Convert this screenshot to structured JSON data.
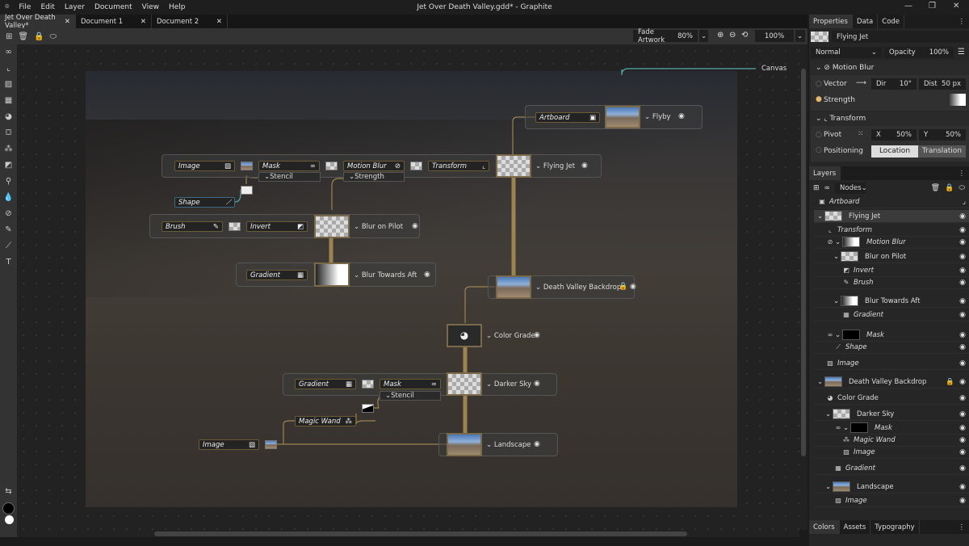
{
  "app": {
    "title": "Jet Over Death Valley.gdd* - Graphite",
    "menu": [
      "File",
      "Edit",
      "Layer",
      "Document",
      "View",
      "Help"
    ]
  },
  "tabs": [
    {
      "label": "Jet Over Death Valley*",
      "active": true
    },
    {
      "label": "Document 1"
    },
    {
      "label": "Document 2"
    }
  ],
  "toolbar": {
    "fade_label": "Fade Artwork",
    "fade_value": "80%",
    "zoom_value": "100%"
  },
  "graph": {
    "canvas_label": "Canvas",
    "flyby": {
      "artboard": "Artboard",
      "label": "Flyby"
    },
    "flying_jet": {
      "image": "Image",
      "mask": "Mask",
      "stencil": "Stencil",
      "motion_blur": "Motion Blur",
      "strength": "Strength",
      "transform": "Transform",
      "label": "Flying Jet",
      "shape": "Shape"
    },
    "blur_on_pilot": {
      "brush": "Brush",
      "invert": "Invert",
      "label": "Blur on Pilot"
    },
    "blur_towards_aft": {
      "gradient": "Gradient",
      "label": "Blur Towards Aft"
    },
    "backdrop": {
      "label": "Death Valley Backdrop"
    },
    "color_grade": {
      "label": "Color Grade"
    },
    "darker_sky": {
      "gradient": "Gradient",
      "mask": "Mask",
      "stencil": "Stencil",
      "magic_wand": "Magic Wand",
      "label": "Darker Sky"
    },
    "landscape": {
      "image": "Image",
      "label": "Landscape"
    }
  },
  "properties": {
    "tabs": [
      "Properties",
      "Data",
      "Code"
    ],
    "layer_name": "Flying Jet",
    "blend_mode": "Normal",
    "opacity_label": "Opacity",
    "opacity_value": "100%",
    "motion_blur": {
      "title": "Motion Blur",
      "vector_label": "Vector",
      "dir_label": "Dir",
      "dir_value": "10°",
      "dist_label": "Dist",
      "dist_value": "50 px",
      "strength_label": "Strength"
    },
    "transform": {
      "title": "Transform",
      "pivot_label": "Pivot",
      "x_label": "X",
      "x_value": "50%",
      "y_label": "Y",
      "y_value": "50%",
      "positioning_label": "Positioning",
      "location": "Location",
      "translation": "Translation"
    }
  },
  "layers": {
    "title": "Layers",
    "view_mode": "Nodes",
    "items": [
      {
        "name": "Artboard",
        "depth": 0,
        "italic": true,
        "icon": "▣"
      },
      {
        "name": "Flying Jet",
        "depth": 0,
        "thumb": "checker",
        "chev": true
      },
      {
        "name": "Transform",
        "depth": 1,
        "italic": true,
        "icon": "⌞"
      },
      {
        "name": "Motion Blur",
        "depth": 1,
        "italic": true,
        "icon": "⊘",
        "thumb": "grad",
        "chev": true
      },
      {
        "name": "Blur on Pilot",
        "depth": 2,
        "thumb": "checker",
        "chev": true
      },
      {
        "name": "Invert",
        "depth": 3,
        "italic": true,
        "icon": "◩"
      },
      {
        "name": "Brush",
        "depth": 3,
        "italic": true,
        "icon": "✎"
      },
      {
        "name": "Blur Towards Aft",
        "depth": 2,
        "thumb": "grad",
        "chev": true
      },
      {
        "name": "Gradient",
        "depth": 3,
        "italic": true,
        "icon": "▦"
      },
      {
        "name": "Mask",
        "depth": 1,
        "italic": true,
        "icon": "∞",
        "thumb": "black",
        "chev": true
      },
      {
        "name": "Shape",
        "depth": 2,
        "italic": true,
        "icon": "⟋"
      },
      {
        "name": "Image",
        "depth": 1,
        "italic": true,
        "icon": "▨"
      },
      {
        "name": "Death Valley Backdrop",
        "depth": 0,
        "thumb": "photo",
        "chev": true,
        "locked": true
      },
      {
        "name": "Color Grade",
        "depth": 1,
        "icon": "◕"
      },
      {
        "name": "Darker Sky",
        "depth": 1,
        "thumb": "checker",
        "chev": true
      },
      {
        "name": "Mask",
        "depth": 2,
        "italic": true,
        "icon": "∞",
        "thumb": "black",
        "chev": true
      },
      {
        "name": "Magic Wand",
        "depth": 3,
        "italic": true,
        "icon": "⁂"
      },
      {
        "name": "Image",
        "depth": 3,
        "italic": true,
        "icon": "▨"
      },
      {
        "name": "Gradient",
        "depth": 2,
        "italic": true,
        "icon": "▦"
      },
      {
        "name": "Landscape",
        "depth": 1,
        "thumb": "photo",
        "chev": true
      },
      {
        "name": "Image",
        "depth": 2,
        "italic": true,
        "icon": "▨"
      }
    ]
  },
  "bottom_tabs": [
    "Colors",
    "Assets",
    "Typography"
  ],
  "colors": {
    "accent": "#e8b86d",
    "wire": "#9c8450",
    "panel": "#262626"
  }
}
